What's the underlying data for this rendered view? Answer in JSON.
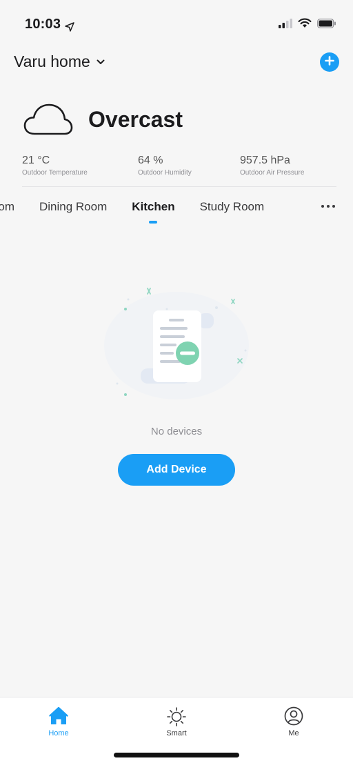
{
  "status_bar": {
    "time": "10:03"
  },
  "header": {
    "home_name": "Varu home"
  },
  "weather": {
    "condition": "Overcast",
    "stats": [
      {
        "value": "21 °C",
        "label": "Outdoor Temperature"
      },
      {
        "value": "64 %",
        "label": "Outdoor Humidity"
      },
      {
        "value": "957.5 hPa",
        "label": "Outdoor Air Pressure"
      }
    ]
  },
  "rooms": {
    "tabs": [
      {
        "label": "Bedroom"
      },
      {
        "label": "Dining Room"
      },
      {
        "label": "Kitchen"
      },
      {
        "label": "Study Room"
      }
    ],
    "active": "Kitchen"
  },
  "empty_state": {
    "message": "No devices",
    "add_button_label": "Add Device"
  },
  "tab_bar": {
    "items": [
      {
        "label": "Home",
        "icon": "home-icon"
      },
      {
        "label": "Smart",
        "icon": "sun-icon"
      },
      {
        "label": "Me",
        "icon": "user-icon"
      }
    ],
    "active": "Home"
  },
  "colors": {
    "accent": "#1a9ef5",
    "background": "#f6f6f6"
  }
}
